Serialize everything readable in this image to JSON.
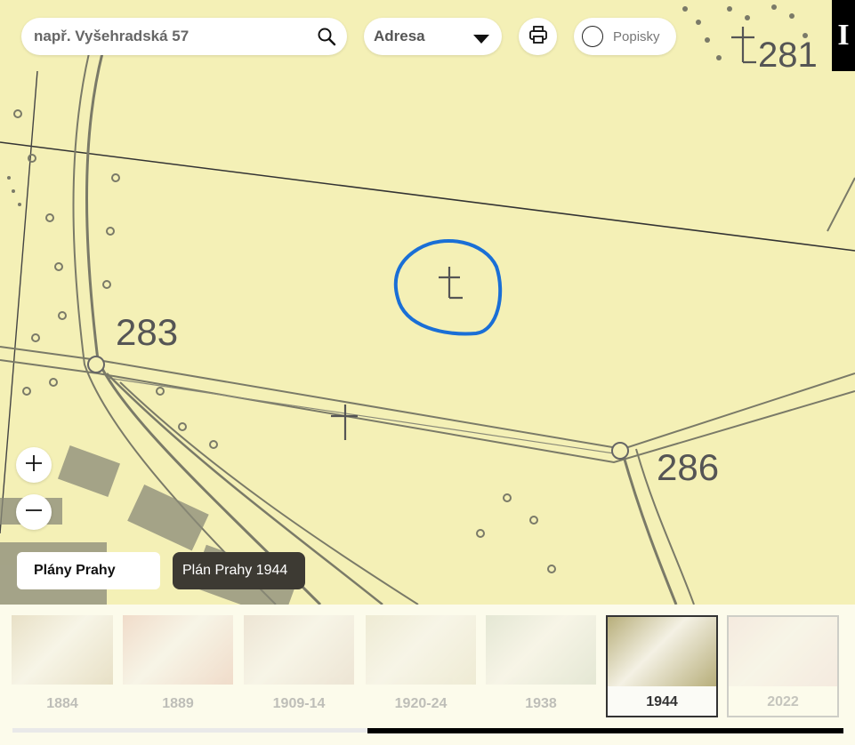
{
  "search": {
    "placeholder": "např. Vyšehradská 57",
    "icon": "search-icon"
  },
  "search_type": {
    "selected": "Adresa",
    "icon": "caret-down-icon"
  },
  "print": {
    "icon": "printer-icon"
  },
  "labels_toggle": {
    "label": "Popisky",
    "checked": false
  },
  "brand": {
    "letter": "I"
  },
  "zoom": {
    "in_icon": "plus-icon",
    "out_icon": "minus-icon"
  },
  "layer_group": {
    "label": "Plány Prahy"
  },
  "current_layer": {
    "label": "Plán Prahy 1944"
  },
  "map_labels": {
    "n281": "281",
    "n283": "283",
    "n286": "286"
  },
  "timeline": {
    "items": [
      {
        "year": "1884",
        "active": false,
        "tone": "#dcd0b0"
      },
      {
        "year": "1889",
        "active": false,
        "tone": "#e9c9b6"
      },
      {
        "year": "1909-14",
        "active": false,
        "tone": "#e4d7c6"
      },
      {
        "year": "1920-24",
        "active": false,
        "tone": "#e6e1c6"
      },
      {
        "year": "1938",
        "active": false,
        "tone": "#d6dbc6"
      },
      {
        "year": "1944",
        "active": true,
        "tone": "#b7ae7a"
      },
      {
        "year": "2022",
        "active": false,
        "tone": "#f0ddd6"
      }
    ]
  },
  "colors": {
    "accent_circle": "#1a6fd6",
    "map_paper": "#f4f0b6",
    "ink": "#6b6b5a"
  }
}
